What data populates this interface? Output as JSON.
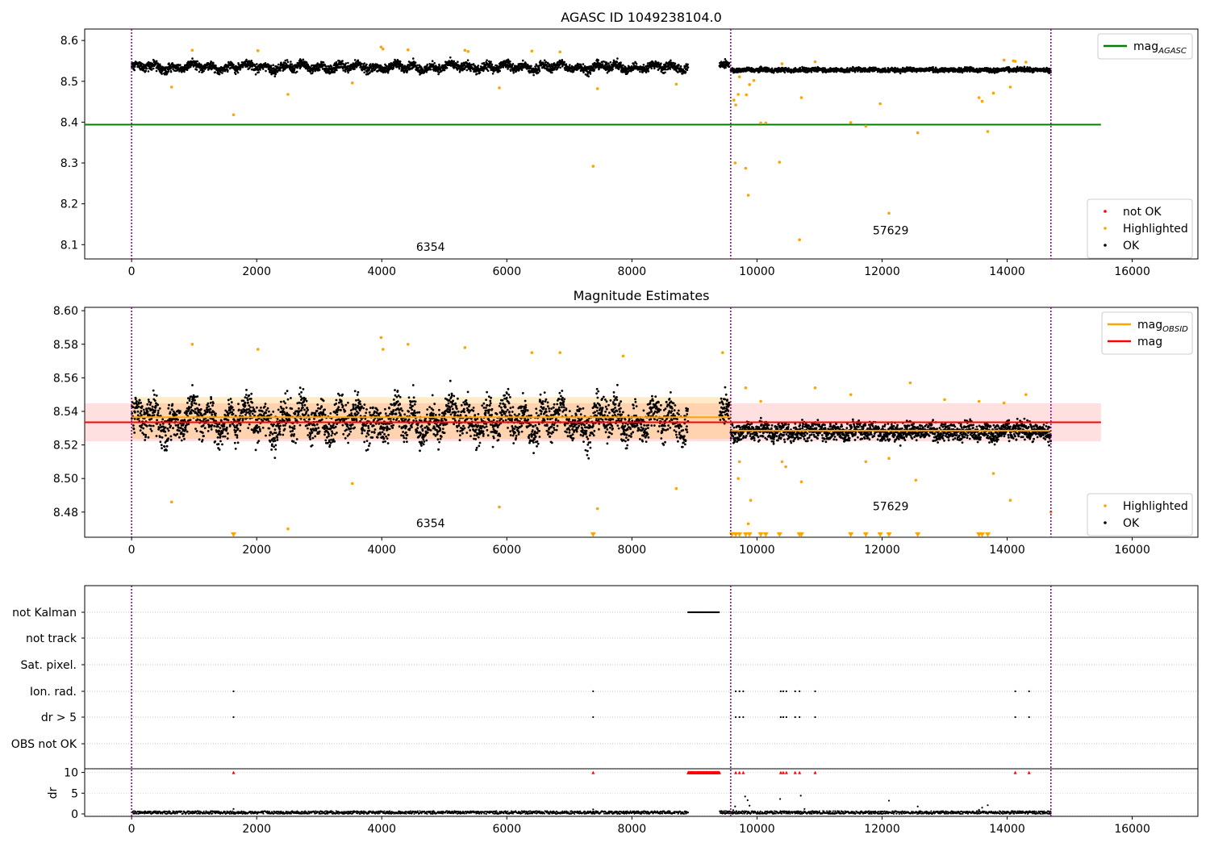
{
  "chart_data": [
    {
      "type": "scatter",
      "title": "AGASC ID 1049238104.0",
      "xlim": [
        -750,
        17050
      ],
      "ylim": [
        8.065,
        8.628
      ],
      "xticks": [
        0,
        2000,
        4000,
        6000,
        8000,
        10000,
        12000,
        14000,
        16000
      ],
      "xtick_labels": [
        "0",
        "2000",
        "4000",
        "6000",
        "8000",
        "10000",
        "12000",
        "14000",
        "16000"
      ],
      "yticks": [
        8.1,
        8.2,
        8.3,
        8.4,
        8.5,
        8.6
      ],
      "ytick_labels": [
        "8.1",
        "8.2",
        "8.3",
        "8.4",
        "8.5",
        "8.6"
      ],
      "vlines": [
        0,
        9580,
        14700
      ],
      "hlines": [
        {
          "name": "mag_AGASC",
          "y": 8.394,
          "x": [
            -750,
            15500
          ],
          "color": "#008000"
        }
      ],
      "annotations": [
        {
          "text": "6354",
          "x": 4550,
          "y": 8.085
        },
        {
          "text": "57629",
          "x": 11850,
          "y": 8.125
        }
      ],
      "legend_top": [
        {
          "label": "mag",
          "sub": "AGASC",
          "color": "#008000",
          "kind": "line"
        }
      ],
      "legend_bottom": [
        {
          "label": "not OK",
          "color": "#ff0000",
          "kind": "dot"
        },
        {
          "label": "Highlighted",
          "color": "#ffa500",
          "kind": "dot"
        },
        {
          "label": "OK",
          "color": "#000000",
          "kind": "dot"
        }
      ],
      "series": [
        {
          "name": "OK",
          "color": "#000000",
          "segments": [
            {
              "x_range": [
                0,
                8900
              ],
              "center": 8.535,
              "spread": 0.012,
              "wave": 0.009
            },
            {
              "x_range": [
                9400,
                9560
              ],
              "center": 8.54,
              "spread": 0.01,
              "wave": 0.006
            },
            {
              "x_range": [
                9580,
                14700
              ],
              "center": 8.528,
              "spread": 0.006,
              "wave": 0.002
            }
          ]
        },
        {
          "name": "Highlighted",
          "color": "#ffa500",
          "x": [
            640,
            970,
            1630,
            2020,
            2500,
            3530,
            3990,
            4020,
            4420,
            5330,
            5380,
            5880,
            6400,
            6850,
            7380,
            7450,
            8710,
            9630,
            9650,
            9660,
            9700,
            9720,
            9820,
            9830,
            9860,
            9880,
            9950,
            10060,
            10140,
            10360,
            10400,
            10680,
            10710,
            10930,
            11500,
            11740,
            11970,
            12110,
            12570,
            13550,
            13600,
            13690,
            13780,
            13950,
            14050,
            14100,
            14130,
            14300
          ],
          "y": [
            8.486,
            8.576,
            8.418,
            8.575,
            8.468,
            8.496,
            8.584,
            8.579,
            8.577,
            8.576,
            8.573,
            8.484,
            8.574,
            8.572,
            8.292,
            8.482,
            8.493,
            8.454,
            8.3,
            8.442,
            8.468,
            8.511,
            8.287,
            8.467,
            8.221,
            8.492,
            8.502,
            8.398,
            8.398,
            8.302,
            8.543,
            8.112,
            8.46,
            8.548,
            8.399,
            8.39,
            8.445,
            8.177,
            8.374,
            8.46,
            8.451,
            8.377,
            8.471,
            8.552,
            8.486,
            8.55,
            8.549,
            8.547
          ]
        }
      ]
    },
    {
      "type": "scatter",
      "title": "Magnitude Estimates",
      "xlim": [
        -750,
        17050
      ],
      "ylim": [
        8.465,
        8.602
      ],
      "xticks": [
        0,
        2000,
        4000,
        6000,
        8000,
        10000,
        12000,
        14000,
        16000
      ],
      "xtick_labels": [
        "0",
        "2000",
        "4000",
        "6000",
        "8000",
        "10000",
        "12000",
        "14000",
        "16000"
      ],
      "yticks": [
        8.48,
        8.5,
        8.52,
        8.54,
        8.56,
        8.58,
        8.6
      ],
      "ytick_labels": [
        "8.48",
        "8.50",
        "8.52",
        "8.54",
        "8.56",
        "8.58",
        "8.60"
      ],
      "vlines": [
        0,
        9580,
        14700
      ],
      "bands": [
        {
          "x": [
            -750,
            15500
          ],
          "y": [
            8.5222,
            8.5448
          ],
          "color": "#ff0000",
          "opacity": 0.12
        },
        {
          "x": [
            0,
            9580
          ],
          "y": [
            8.5235,
            8.5485
          ],
          "color": "#ffa500",
          "opacity": 0.22
        }
      ],
      "hlines": [
        {
          "name": "mag_OBSID",
          "y": 8.5365,
          "x": [
            0,
            9580
          ],
          "color": "#ffa500"
        },
        {
          "name": "mag_OBSID",
          "y": 8.5285,
          "x": [
            9580,
            14700
          ],
          "color": "#ffa500"
        },
        {
          "name": "mag",
          "y": 8.5335,
          "x": [
            -750,
            15500
          ],
          "color": "#ff0000"
        }
      ],
      "annotations": [
        {
          "text": "6354",
          "x": 4550,
          "y": 8.471
        },
        {
          "text": "57629",
          "x": 11850,
          "y": 8.481
        }
      ],
      "legend_top": [
        {
          "label": "mag",
          "sub": "OBSID",
          "color": "#ffa500",
          "kind": "line"
        },
        {
          "label": "mag",
          "sub": "",
          "color": "#ff0000",
          "kind": "line"
        }
      ],
      "legend_bottom": [
        {
          "label": "Highlighted",
          "color": "#ffa500",
          "kind": "dot"
        },
        {
          "label": "OK",
          "color": "#000000",
          "kind": "dot"
        }
      ],
      "series": [
        {
          "name": "OK",
          "color": "#000000",
          "segments": [
            {
              "x_range": [
                0,
                8900
              ],
              "center": 8.535,
              "spread": 0.012,
              "wave": 0.009
            },
            {
              "x_range": [
                9400,
                9560
              ],
              "center": 8.54,
              "spread": 0.01,
              "wave": 0.006
            },
            {
              "x_range": [
                9580,
                14700
              ],
              "center": 8.528,
              "spread": 0.006,
              "wave": 0.002
            }
          ]
        },
        {
          "name": "Highlighted",
          "color": "#ffa500",
          "x": [
            640,
            970,
            2020,
            2500,
            3530,
            3990,
            4020,
            4420,
            5330,
            5880,
            6400,
            6850,
            7450,
            7860,
            8710,
            9450,
            9700,
            9720,
            9820,
            9860,
            9900,
            10060,
            10400,
            10460,
            10710,
            10930,
            11500,
            11740,
            12110,
            12450,
            12540,
            13000,
            13550,
            13780,
            13950,
            14050,
            14300,
            14700
          ],
          "y": [
            8.486,
            8.58,
            8.577,
            8.47,
            8.497,
            8.584,
            8.577,
            8.58,
            8.578,
            8.483,
            8.575,
            8.575,
            8.482,
            8.573,
            8.494,
            8.575,
            8.5,
            8.51,
            8.554,
            8.473,
            8.487,
            8.546,
            8.51,
            8.507,
            8.498,
            8.554,
            8.55,
            8.51,
            8.512,
            8.557,
            8.499,
            8.547,
            8.546,
            8.503,
            8.545,
            8.487,
            8.55,
            8.48
          ]
        },
        {
          "name": "Highlighted (below range)",
          "color": "#ffa500",
          "marker": "triangle-down",
          "x": [
            1630,
            7380,
            9600,
            9660,
            9720,
            9820,
            9880,
            10060,
            10140,
            10360,
            10680,
            10710,
            11500,
            11740,
            11970,
            12110,
            12570,
            13550,
            13600,
            13690
          ],
          "y": [
            8.466,
            8.466,
            8.466,
            8.466,
            8.466,
            8.466,
            8.466,
            8.466,
            8.466,
            8.466,
            8.466,
            8.466,
            8.466,
            8.466,
            8.466,
            8.466,
            8.466,
            8.466,
            8.466,
            8.466
          ]
        }
      ]
    },
    {
      "type": "scatter",
      "title": "",
      "xlim": [
        -750,
        17050
      ],
      "xticks": [
        0,
        2000,
        4000,
        6000,
        8000,
        10000,
        12000,
        14000,
        16000
      ],
      "xtick_labels": [
        "0",
        "2000",
        "4000",
        "6000",
        "8000",
        "10000",
        "12000",
        "14000",
        "16000"
      ],
      "vlines": [
        0,
        9580,
        14700
      ],
      "categories": [
        "not Kalman",
        "not track",
        "Sat. pixel.",
        "Ion. rad.",
        "dr > 5",
        "OBS not OK"
      ],
      "flags": [
        {
          "category": "not Kalman",
          "x_range": [
            8900,
            9400
          ]
        },
        {
          "category": "Ion. rad.",
          "x": [
            1630,
            7380,
            9660,
            9720,
            9780,
            10380,
            10420,
            10470,
            10610,
            10680,
            10930,
            14130,
            14350
          ]
        },
        {
          "category": "dr > 5",
          "x": [
            1630,
            7380,
            9660,
            9720,
            9780,
            10380,
            10420,
            10470,
            10610,
            10680,
            10930,
            14130,
            14350
          ]
        }
      ],
      "dr_panel": {
        "ylabel": "dr",
        "ylim": [
          0,
          10.5
        ],
        "yticks": [
          0,
          5,
          10
        ],
        "ytick_labels": [
          "0",
          "5",
          "10"
        ],
        "capped_value": 10,
        "capped_x": [
          1630,
          7380,
          8900,
          8950,
          9000,
          9050,
          9100,
          9150,
          9200,
          9250,
          9300,
          9350,
          9400,
          9660,
          9720,
          9780,
          10380,
          10420,
          10470,
          10610,
          10680,
          10930,
          14130,
          14350
        ],
        "outliers_x": [
          1630,
          7380,
          9620,
          9650,
          9810,
          9850,
          9880,
          10370,
          10700,
          10760,
          12110,
          12570,
          13550,
          13600,
          13690
        ],
        "outliers_y": [
          1.2,
          1.1,
          0.9,
          1.8,
          4.2,
          3.3,
          2.0,
          3.6,
          4.4,
          1.2,
          3.2,
          1.8,
          1.0,
          1.5,
          2.1
        ]
      }
    }
  ]
}
